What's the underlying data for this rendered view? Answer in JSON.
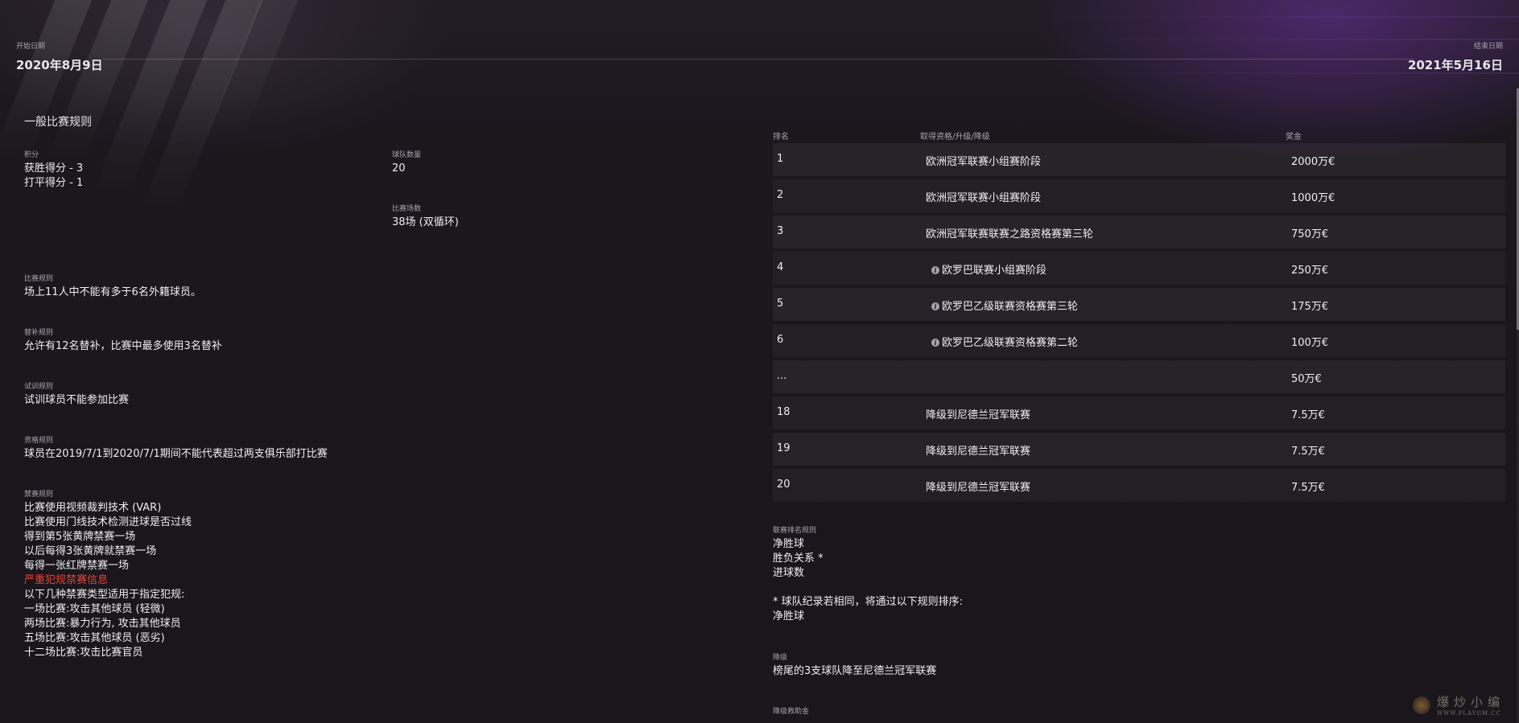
{
  "header": {
    "start_label": "开始日期",
    "start_date": "2020年8月9日",
    "end_label": "结束日期",
    "end_date": "2021年5月16日"
  },
  "rules": {
    "title": "一般比赛规则",
    "points": {
      "label": "积分",
      "lines": [
        "获胜得分 - 3",
        "打平得分 - 1"
      ]
    },
    "teams": {
      "label": "球队数量",
      "value": "20"
    },
    "matches": {
      "label": "比赛场数",
      "value": "38场 (双循环)"
    },
    "match_rules": {
      "label": "比赛规则",
      "value": "场上11人中不能有多于6名外籍球员。"
    },
    "subs": {
      "label": "替补规则",
      "value": "允许有12名替补，比赛中最多使用3名替补"
    },
    "trial": {
      "label": "试训规则",
      "value": "试训球员不能参加比赛"
    },
    "eligibility": {
      "label": "资格规则",
      "value": "球员在2019/7/1到2020/7/1期间不能代表超过两支俱乐部打比赛"
    },
    "bans": {
      "label": "禁赛规则",
      "lines": [
        "比赛使用视频裁判技术 (VAR)",
        "比赛使用门线技术检测进球是否过线",
        "得到第5张黄牌禁赛一场",
        "以后每得3张黄牌就禁赛一场",
        "每得一张红牌禁赛一场"
      ],
      "link": "严重犯规禁赛信息",
      "more": [
        "以下几种禁赛类型适用于指定犯规:",
        "一场比赛:攻击其他球员 (轻微)",
        "两场比赛:暴力行为, 攻击其他球员",
        "五场比赛:攻击其他球员 (恶劣)",
        "十二场比赛:攻击比赛官员"
      ]
    }
  },
  "table": {
    "headers": {
      "rank": "排名",
      "qualification": "取得资格/升级/降级",
      "prize": "奖金"
    },
    "rows": [
      {
        "rank": "1",
        "qualification": "欧洲冠军联赛小组赛阶段",
        "prize": "2000万€",
        "info": false
      },
      {
        "rank": "2",
        "qualification": "欧洲冠军联赛小组赛阶段",
        "prize": "1000万€",
        "info": false
      },
      {
        "rank": "3",
        "qualification": "欧洲冠军联赛联赛之路资格赛第三轮",
        "prize": "750万€",
        "info": false
      },
      {
        "rank": "4",
        "qualification": "欧罗巴联赛小组赛阶段",
        "prize": "250万€",
        "info": true
      },
      {
        "rank": "5",
        "qualification": "欧罗巴乙级联赛资格赛第三轮",
        "prize": "175万€",
        "info": true
      },
      {
        "rank": "6",
        "qualification": "欧罗巴乙级联赛资格赛第二轮",
        "prize": "100万€",
        "info": true
      },
      {
        "rank": "...",
        "qualification": "",
        "prize": "50万€",
        "info": false
      },
      {
        "rank": "18",
        "qualification": "降级到尼德兰冠军联赛",
        "prize": "7.5万€",
        "info": false
      },
      {
        "rank": "19",
        "qualification": "降级到尼德兰冠军联赛",
        "prize": "7.5万€",
        "info": false
      },
      {
        "rank": "20",
        "qualification": "降级到尼德兰冠军联赛",
        "prize": "7.5万€",
        "info": false
      }
    ]
  },
  "ranking_rules": {
    "label": "联赛排名规则",
    "lines": [
      "净胜球",
      "胜负关系 *",
      "进球数"
    ],
    "note": "* 球队纪录若相同，将通过以下规则排序:",
    "note_lines": [
      "净胜球"
    ]
  },
  "relegation": {
    "label": "降级",
    "value": "榜尾的3支球队降至尼德兰冠军联赛"
  },
  "parachute": {
    "label": "降级救助金"
  },
  "watermark": {
    "line1": "爆炒小编",
    "line2": "WWW.PLAYGM.CC"
  }
}
